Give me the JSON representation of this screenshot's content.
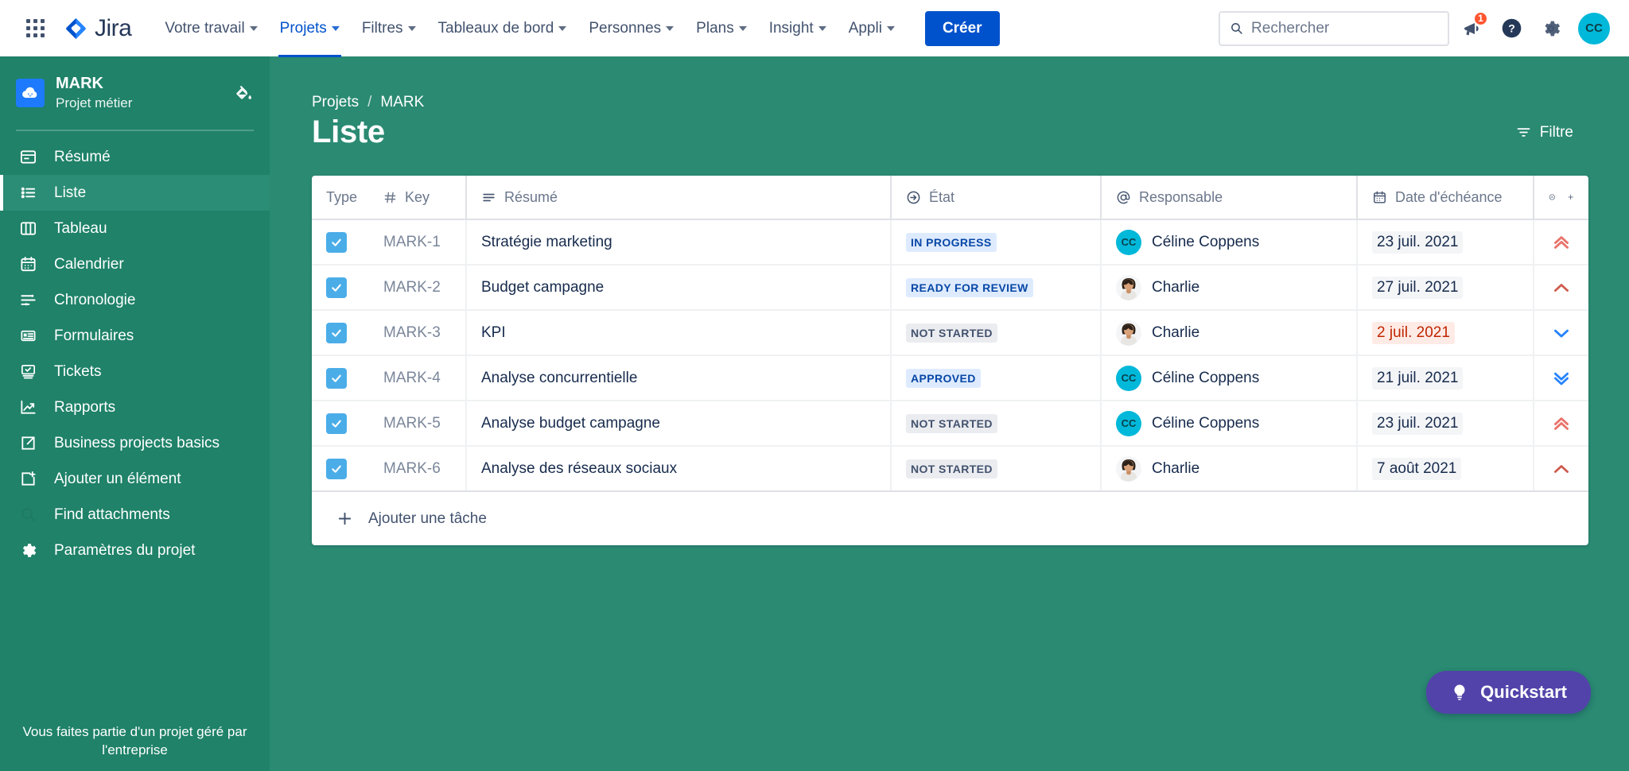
{
  "topnav": {
    "app_switcher": "apps-grid-icon",
    "brand": "Jira",
    "items": [
      {
        "label": "Votre travail",
        "has_caret": true,
        "active": false
      },
      {
        "label": "Projets",
        "has_caret": true,
        "active": true
      },
      {
        "label": "Filtres",
        "has_caret": true,
        "active": false
      },
      {
        "label": "Tableaux de bord",
        "has_caret": true,
        "active": false
      },
      {
        "label": "Personnes",
        "has_caret": true,
        "active": false
      },
      {
        "label": "Plans",
        "has_caret": true,
        "active": false
      },
      {
        "label": "Insight",
        "has_caret": true,
        "active": false
      },
      {
        "label": "Appli",
        "has_caret": true,
        "active": false
      }
    ],
    "create_label": "Créer",
    "search_placeholder": "Rechercher",
    "search_value": "",
    "notification_count": "1",
    "avatar_initials": "CC"
  },
  "sidebar": {
    "project_name": "MARK",
    "project_type": "Projet métier",
    "items": [
      {
        "label": "Résumé",
        "icon": "summary-icon",
        "selected": false
      },
      {
        "label": "Liste",
        "icon": "list-icon",
        "selected": true
      },
      {
        "label": "Tableau",
        "icon": "board-icon",
        "selected": false
      },
      {
        "label": "Calendrier",
        "icon": "calendar-icon",
        "selected": false
      },
      {
        "label": "Chronologie",
        "icon": "timeline-icon",
        "selected": false
      },
      {
        "label": "Formulaires",
        "icon": "forms-icon",
        "selected": false
      },
      {
        "label": "Tickets",
        "icon": "issues-icon",
        "selected": false
      },
      {
        "label": "Rapports",
        "icon": "reports-icon",
        "selected": false
      },
      {
        "label": "Business projects basics",
        "icon": "external-link-icon",
        "selected": false
      },
      {
        "label": "Ajouter un élément",
        "icon": "add-item-icon",
        "selected": false
      },
      {
        "label": "Find attachments",
        "icon": "search-icon",
        "selected": false
      },
      {
        "label": "Paramètres du projet",
        "icon": "gear-icon",
        "selected": false
      }
    ],
    "footer_note": "Vous faites partie d'un projet géré par l'entreprise"
  },
  "main": {
    "breadcrumb": {
      "root": "Projets",
      "separator": "/",
      "current": "MARK"
    },
    "page_title": "Liste",
    "filter_label": "Filtre",
    "add_task_label": "Ajouter une tâche",
    "quickstart_label": "Quickstart"
  },
  "table": {
    "columns": [
      {
        "label": "Type",
        "icon": ""
      },
      {
        "label": "Key",
        "icon": "hash-icon"
      },
      {
        "label": "Résumé",
        "icon": "text-lines-icon"
      },
      {
        "label": "État",
        "icon": "arrow-circle-icon"
      },
      {
        "label": "Responsable",
        "icon": "at-icon"
      },
      {
        "label": "Date d'échéance",
        "icon": "calendar-icon"
      }
    ],
    "collapse_icon": "chevron-up-circle-icon",
    "add_column_icon": "plus-icon",
    "rows": [
      {
        "checked": true,
        "key": "MARK-1",
        "summary": "Stratégie marketing",
        "state": "IN PROGRESS",
        "state_style": "blue",
        "assignee": "Céline Coppens",
        "avatar_type": "initials",
        "avatar_initials": "CC",
        "due": "23 juil. 2021",
        "overdue": false,
        "priority": "highest"
      },
      {
        "checked": true,
        "key": "MARK-2",
        "summary": "Budget campagne",
        "state": "READY FOR REVIEW",
        "state_style": "blue",
        "assignee": "Charlie",
        "avatar_type": "photo",
        "avatar_initials": "",
        "due": "27 juil. 2021",
        "overdue": false,
        "priority": "high"
      },
      {
        "checked": true,
        "key": "MARK-3",
        "summary": "KPI",
        "state": "NOT STARTED",
        "state_style": "gray",
        "assignee": "Charlie",
        "avatar_type": "photo",
        "avatar_initials": "",
        "due": "2 juil. 2021",
        "overdue": true,
        "priority": "low"
      },
      {
        "checked": true,
        "key": "MARK-4",
        "summary": "Analyse concurrentielle",
        "state": "APPROVED",
        "state_style": "blue",
        "assignee": "Céline Coppens",
        "avatar_type": "initials",
        "avatar_initials": "CC",
        "due": "21 juil. 2021",
        "overdue": false,
        "priority": "lowest"
      },
      {
        "checked": true,
        "key": "MARK-5",
        "summary": "Analyse budget campagne",
        "state": "NOT STARTED",
        "state_style": "gray",
        "assignee": "Céline Coppens",
        "avatar_type": "initials",
        "avatar_initials": "CC",
        "due": "23 juil. 2021",
        "overdue": false,
        "priority": "highest"
      },
      {
        "checked": true,
        "key": "MARK-6",
        "summary": "Analyse des réseaux sociaux",
        "state": "NOT STARTED",
        "state_style": "gray",
        "assignee": "Charlie",
        "avatar_type": "photo",
        "avatar_initials": "",
        "due": "7 août 2021",
        "overdue": false,
        "priority": "high"
      }
    ]
  },
  "colors": {
    "sidebar_bg": "#1f8269",
    "main_bg": "#2a8a72",
    "accent_blue": "#0052cc",
    "quickstart_purple": "#5243aa",
    "overdue_red": "#bf2600",
    "priority_high": "#e9736a",
    "priority_low": "#2684ff"
  }
}
